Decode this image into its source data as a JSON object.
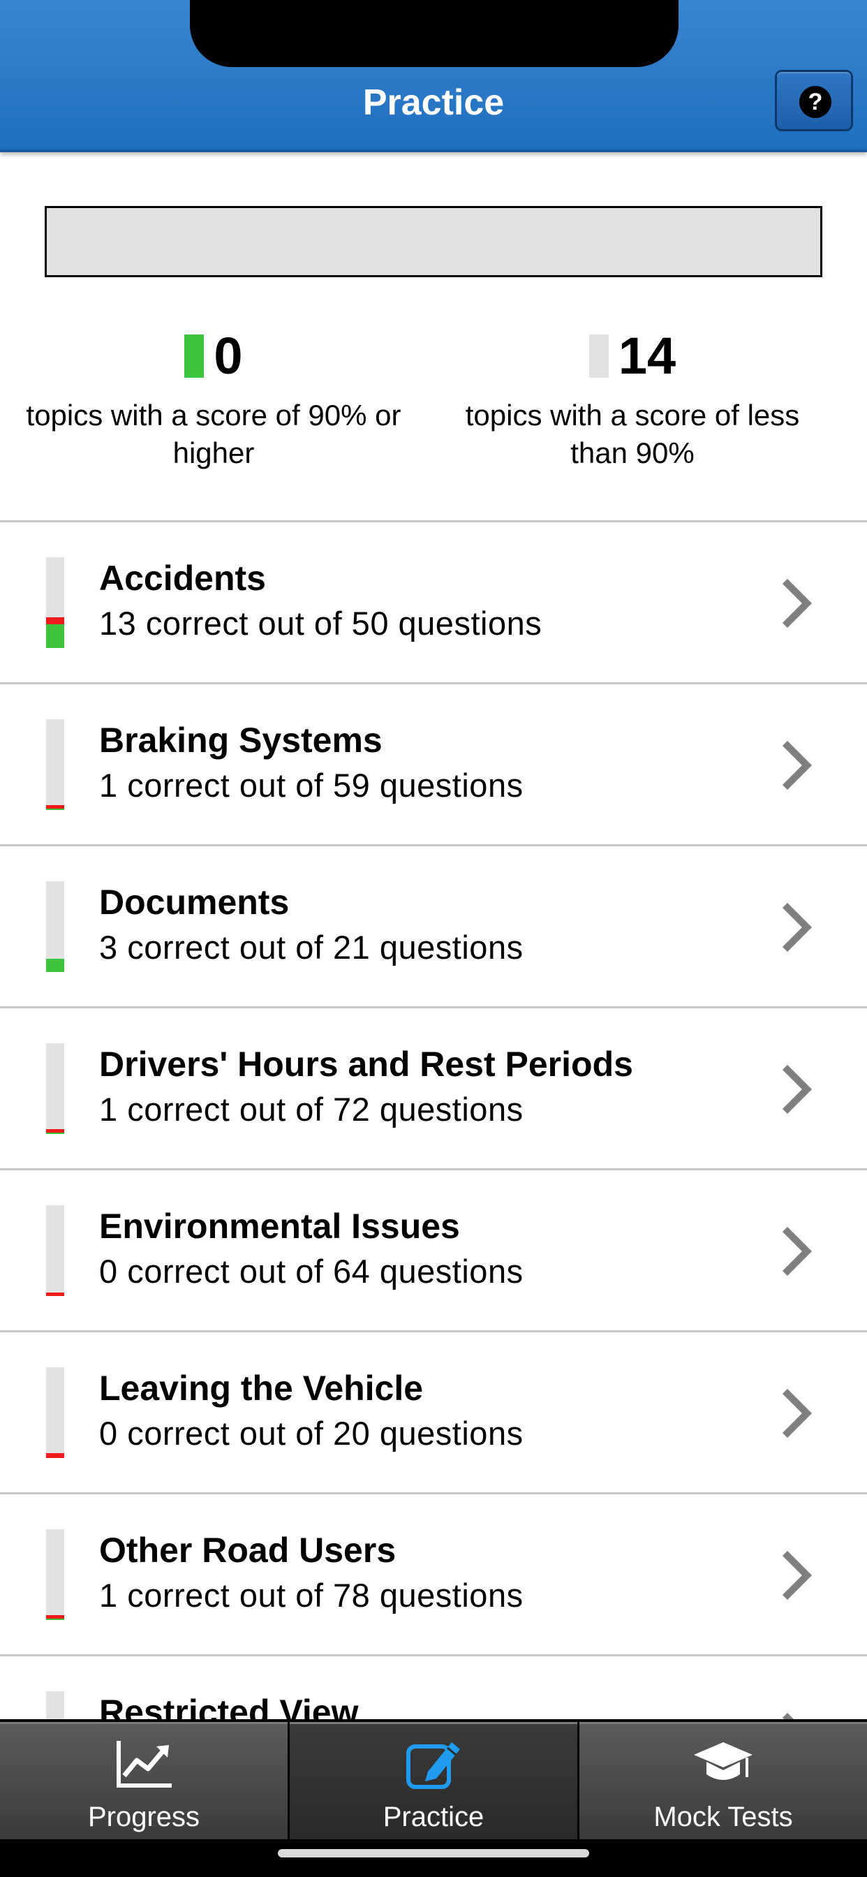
{
  "header": {
    "title": "Practice",
    "help_label": "?"
  },
  "summary": {
    "high": {
      "count": "0",
      "label": "topics with a score of 90% or higher",
      "color": "#3cc43c"
    },
    "low": {
      "count": "14",
      "label": "topics with a score of less than 90%",
      "color": "#e2e2e2"
    }
  },
  "topics": [
    {
      "title": "Accidents",
      "subtitle": "13 correct out of 50 questions",
      "correct": 13,
      "incorrect": 4,
      "total": 50
    },
    {
      "title": "Braking Systems",
      "subtitle": "1 correct out of 59 questions",
      "correct": 1,
      "incorrect": 1,
      "total": 59
    },
    {
      "title": "Documents",
      "subtitle": "3 correct out of 21 questions",
      "correct": 3,
      "incorrect": 0,
      "total": 21
    },
    {
      "title": "Drivers' Hours and Rest Periods",
      "subtitle": "1 correct out of 72 questions",
      "correct": 1,
      "incorrect": 1,
      "total": 72
    },
    {
      "title": "Environmental Issues",
      "subtitle": "0 correct out of 64 questions",
      "correct": 0,
      "incorrect": 1,
      "total": 64
    },
    {
      "title": "Leaving the Vehicle",
      "subtitle": "0 correct out of 20 questions",
      "correct": 0,
      "incorrect": 1,
      "total": 20
    },
    {
      "title": "Other Road Users",
      "subtitle": "1 correct out of 78 questions",
      "correct": 1,
      "incorrect": 1,
      "total": 78
    },
    {
      "title": "Restricted View",
      "subtitle": "",
      "correct": 0,
      "incorrect": 0,
      "total": 0
    }
  ],
  "colors": {
    "correct": "#3cc43c",
    "incorrect": "#f21b1b",
    "accent": "#1f9bf0"
  },
  "tabs": [
    {
      "label": "Progress",
      "icon": "chart-line-icon",
      "active": false
    },
    {
      "label": "Practice",
      "icon": "edit-icon",
      "active": true
    },
    {
      "label": "Mock Tests",
      "icon": "graduation-cap-icon",
      "active": false
    }
  ]
}
